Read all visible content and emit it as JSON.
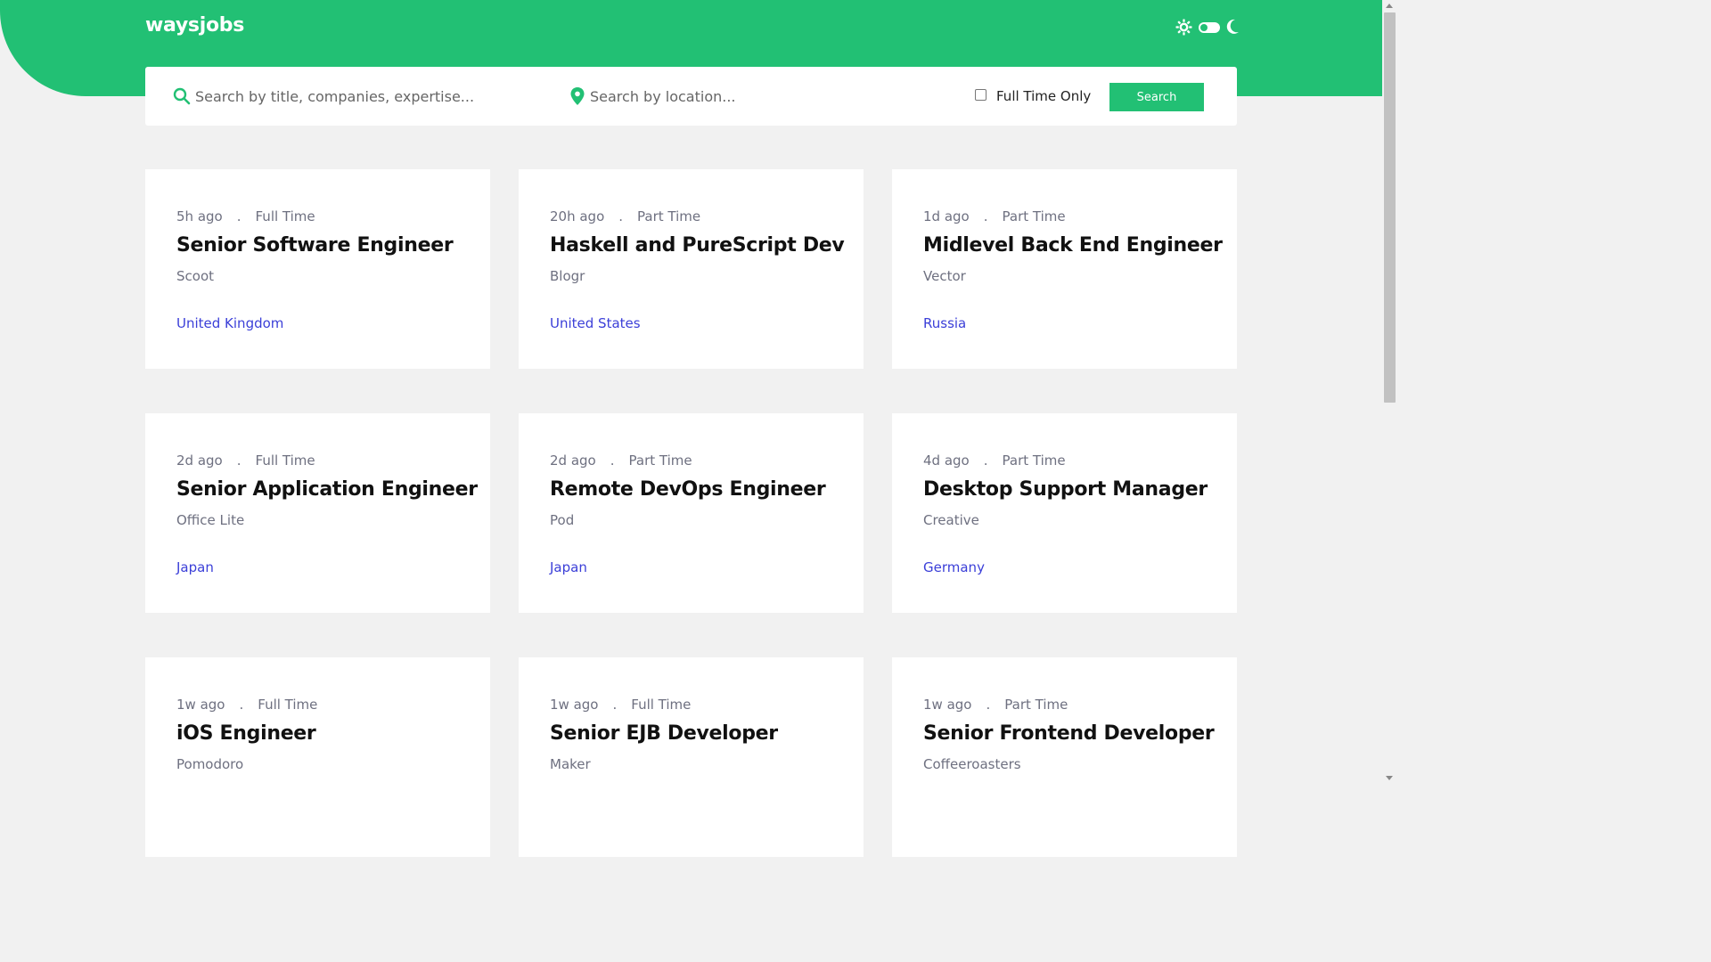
{
  "header": {
    "logo": "waysjobs",
    "brand_color": "#22c074",
    "theme_icons": [
      "sun-icon",
      "moon-icon"
    ]
  },
  "search": {
    "title_placeholder": "Search by title, companies, expertise...",
    "location_placeholder": "Search by location...",
    "fulltime_label": "Full Time Only",
    "fulltime_checked": false,
    "button_label": "Search"
  },
  "jobs": [
    {
      "time": "5h ago",
      "sep": ".",
      "type": "Full Time",
      "title": "Senior Software Engineer",
      "company": "Scoot",
      "location": "United Kingdom"
    },
    {
      "time": "20h ago",
      "sep": ".",
      "type": "Part Time",
      "title": "Haskell and PureScript Dev",
      "company": "Blogr",
      "location": "United States"
    },
    {
      "time": "1d ago",
      "sep": ".",
      "type": "Part Time",
      "title": "Midlevel Back End Engineer",
      "company": "Vector",
      "location": "Russia"
    },
    {
      "time": "2d ago",
      "sep": ".",
      "type": "Full Time",
      "title": "Senior Application Engineer",
      "company": "Office Lite",
      "location": "Japan"
    },
    {
      "time": "2d ago",
      "sep": ".",
      "type": "Part Time",
      "title": "Remote DevOps Engineer",
      "company": "Pod",
      "location": "Japan"
    },
    {
      "time": "4d ago",
      "sep": ".",
      "type": "Part Time",
      "title": "Desktop Support Manager",
      "company": "Creative",
      "location": "Germany"
    },
    {
      "time": "1w ago",
      "sep": ".",
      "type": "Full Time",
      "title": "iOS Engineer",
      "company": "Pomodoro",
      "location": ""
    },
    {
      "time": "1w ago",
      "sep": ".",
      "type": "Full Time",
      "title": "Senior EJB Developer",
      "company": "Maker",
      "location": ""
    },
    {
      "time": "1w ago",
      "sep": ".",
      "type": "Part Time",
      "title": "Senior Frontend Developer",
      "company": "Coffeeroasters",
      "location": ""
    }
  ]
}
